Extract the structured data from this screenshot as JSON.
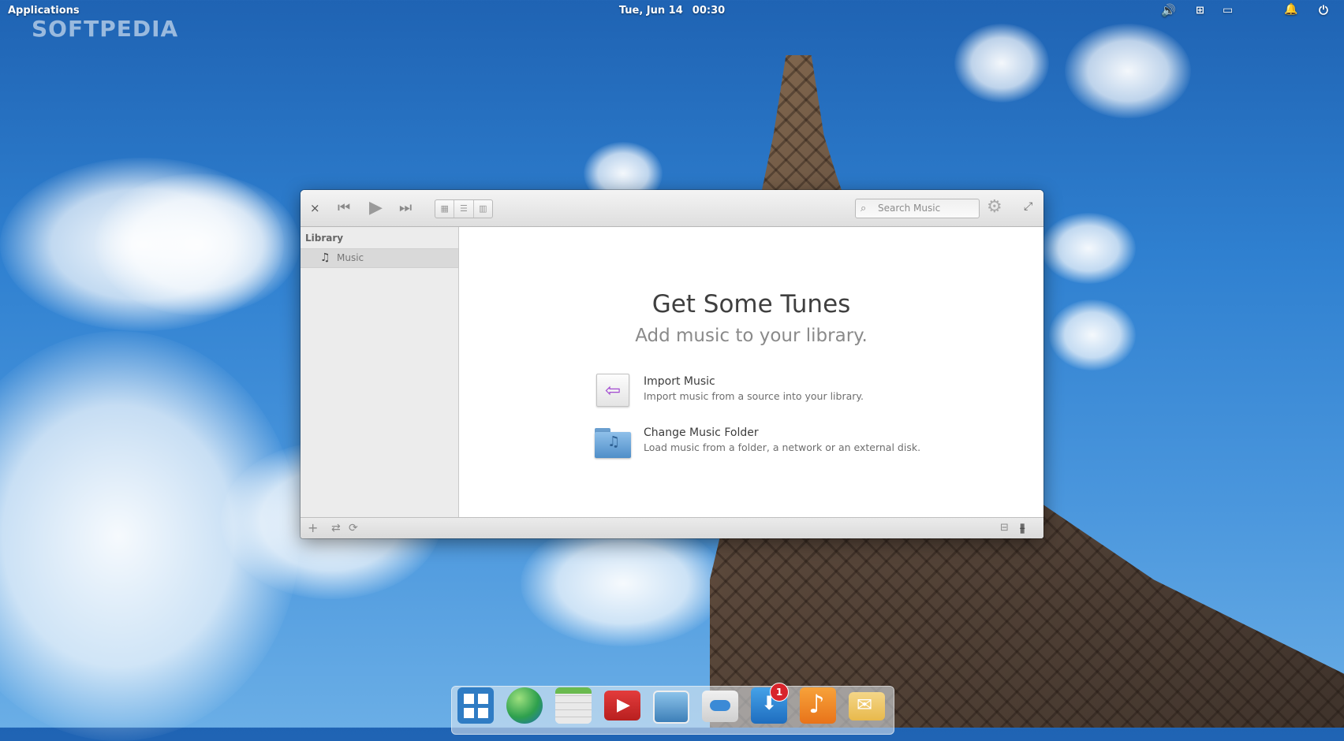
{
  "watermark": "SOFTPEDIA",
  "panel": {
    "applications_label": "Applications",
    "date": "Tue, Jun 14",
    "time": "00:30",
    "indicators": [
      "volume-icon",
      "network-icon",
      "battery-icon",
      "notifications-icon",
      "power-icon"
    ]
  },
  "window": {
    "toolbar": {
      "close_label": "×",
      "previous_label": "⏮",
      "play_label": "▶",
      "next_label": "⏭",
      "view_modes": [
        "grid-view-icon",
        "list-view-icon",
        "column-view-icon"
      ],
      "search_placeholder": "Search Music",
      "settings_icon": "gear-icon",
      "fullscreen_icon": "expand-icon"
    },
    "sidebar": {
      "header": "Library",
      "items": [
        {
          "label": "Music",
          "icon": "music-note-icon",
          "selected": true
        }
      ]
    },
    "welcome": {
      "title": "Get Some Tunes",
      "subtitle": "Add music to your library.",
      "options": [
        {
          "title": "Import Music",
          "description": "Import music from a source into your library.",
          "icon": "import-arrow-icon"
        },
        {
          "title": "Change Music Folder",
          "description": "Load music from a folder, a network or an external disk.",
          "icon": "music-folder-icon"
        }
      ]
    },
    "bottombar": {
      "add_label": "+",
      "shuffle_label": "⇄",
      "repeat_label": "⟳",
      "info_icon": "info-panel-icon",
      "equalizer_icon": "equalizer-icon"
    }
  },
  "dock": {
    "apps": [
      "files",
      "web-browser",
      "calendar",
      "videos",
      "photos",
      "system-settings",
      "appcenter",
      "music",
      "mail"
    ],
    "appcenter_badge": "1"
  }
}
